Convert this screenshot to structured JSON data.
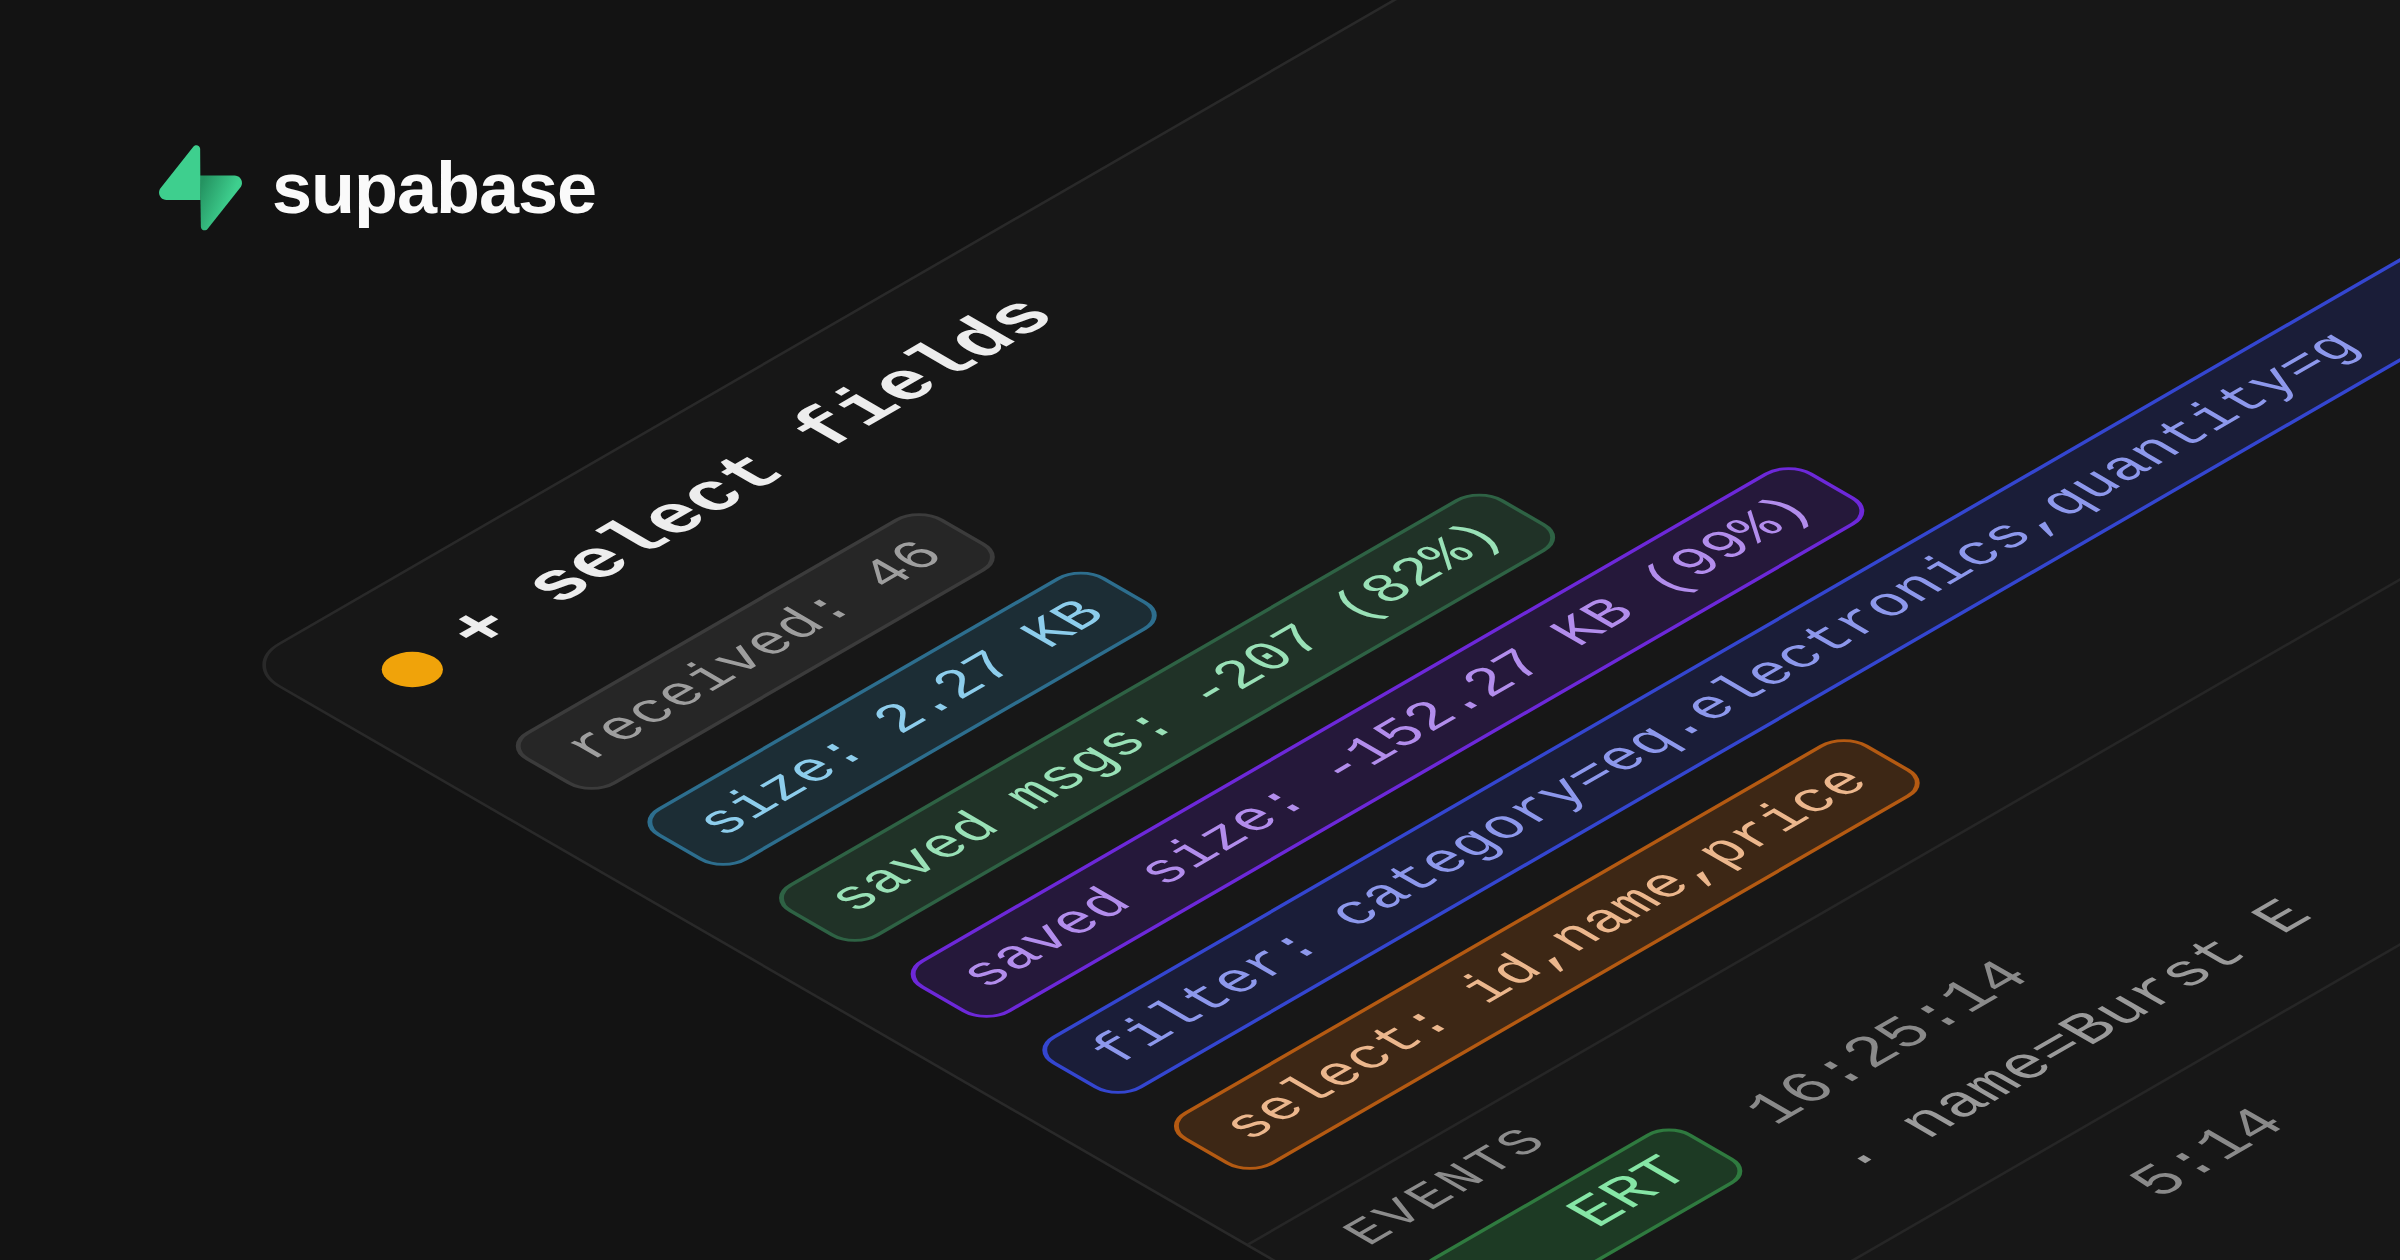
{
  "brand": {
    "name": "supabase"
  },
  "panel": {
    "status_dot": {
      "color": "#f0a30a"
    },
    "title": "+ select fields",
    "tags": [
      {
        "label": "received: 46",
        "color": "#3b3b3b"
      },
      {
        "label": "size: 2.27 KB",
        "color": "#2d6e8e"
      },
      {
        "label": "saved msgs: -207 (82%)",
        "color": "#2e6244"
      },
      {
        "label": "saved size: -152.27 KB (99%)",
        "color": "#6d28d9"
      },
      {
        "label": "filter: category=eq.electronics,quantity=g",
        "color": "#3446d0"
      },
      {
        "label": "select: id,name,price",
        "color": "#b45a12"
      }
    ],
    "events": {
      "label": "EVENTS",
      "rows": [
        {
          "badge": "ERT",
          "time": "16:25:14",
          "detail": "· name=Burst E"
        },
        {
          "time": "5:14"
        }
      ]
    }
  }
}
